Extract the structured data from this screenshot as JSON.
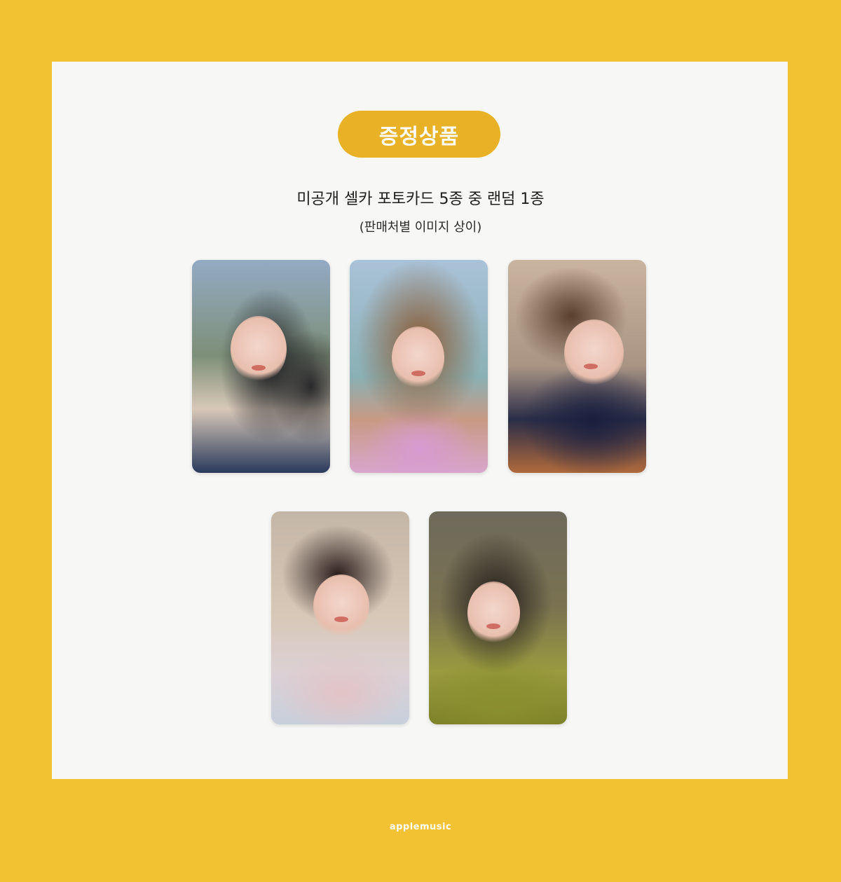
{
  "badge": {
    "label": "증정상품"
  },
  "description": {
    "headline": "미공개 셀카 포토카드 5종 중 랜덤 1종",
    "note": "(판매처별 이미지 상이)"
  },
  "photocards": [
    {
      "id": "card-1"
    },
    {
      "id": "card-2"
    },
    {
      "id": "card-3"
    },
    {
      "id": "card-4"
    },
    {
      "id": "card-5"
    }
  ],
  "footer": {
    "brand": "applemusic"
  },
  "colors": {
    "background": "#f3c232",
    "panel": "#f7f7f6",
    "badge": "#e8b126",
    "text": "#1e1e1e"
  }
}
